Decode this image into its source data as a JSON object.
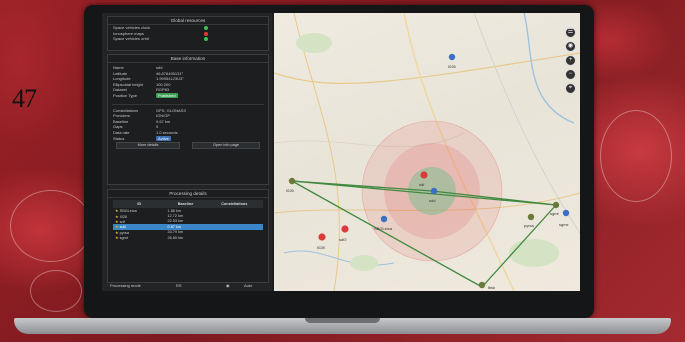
{
  "page_number": "47",
  "global_resources": {
    "title": "Global resources",
    "items": [
      {
        "label": "Space vehicles clock",
        "status_color": "#3fbf4f"
      },
      {
        "label": "Ionosphere maps",
        "status_color": "#e23a2d"
      },
      {
        "label": "Space vehicles orbit",
        "status_color": "#3fbf4f"
      }
    ]
  },
  "base_information": {
    "title": "Base information",
    "fields": [
      {
        "key": "Name",
        "value": "sdd"
      },
      {
        "key": "Latitude",
        "value": "46.878455131°"
      },
      {
        "key": "Longitude",
        "value": "1.99954123U3°"
      },
      {
        "key": "Ellipsoidal height",
        "value": "100.200"
      },
      {
        "key": "Dataset",
        "value": "RGP83"
      },
      {
        "key": "Position Type",
        "value": "Published"
      }
    ],
    "fields2": [
      {
        "key": "Constellations",
        "value": "GPS, GLONASS"
      },
      {
        "key": "Providers",
        "value": "IGN/GP"
      },
      {
        "key": "Baseline",
        "value": "0.67 km"
      },
      {
        "key": "Gaps",
        "value": "0"
      },
      {
        "key": "Data rate",
        "value": "1.0 seconds"
      },
      {
        "key": "Status",
        "value": "Active"
      }
    ],
    "more_details": "More details",
    "open_info": "Open info page"
  },
  "processing_details": {
    "title": "Processing details",
    "headers": [
      "ID",
      "Baseline",
      "Constellations"
    ],
    "rows": [
      {
        "id": "SBGLeica",
        "baseline": "1.88 km"
      },
      {
        "id": "I026",
        "baseline": "12.72 km"
      },
      {
        "id": "sdf",
        "baseline": "22.53 km"
      },
      {
        "id": "sdd",
        "baseline": "0.67 km",
        "selected": true
      },
      {
        "id": "pyrsa",
        "baseline": "33.79 km"
      },
      {
        "id": "sgmt",
        "baseline": "26.80 km"
      }
    ],
    "mode_label": "Processing mode",
    "mode_value": "RS",
    "mode_option": "Auto"
  },
  "map": {
    "pins": [
      {
        "label": "I026",
        "color": "#3a6fc4"
      },
      {
        "label": "I026",
        "color": "#6a7a3a"
      },
      {
        "label": "sdf",
        "color": "#d93b3b"
      },
      {
        "label": "sdd",
        "color": "#3a6fc4"
      },
      {
        "label": "SBGLeica",
        "color": "#3a6fc4"
      },
      {
        "label": "I028",
        "color": "#d93b3b"
      },
      {
        "label": "sdf2",
        "color": "#d93b3b"
      },
      {
        "label": "pyrsa",
        "color": "#6a7a3a"
      },
      {
        "label": "sgmt",
        "color": "#6a7a3a"
      },
      {
        "label": "sgmx",
        "color": "#3a6fc4"
      },
      {
        "label": "lbsk",
        "color": "#6a7a3a"
      }
    ],
    "line_color": "#3f8a3f",
    "circle_color": "#e04848",
    "tools": [
      "layers-icon",
      "target-icon",
      "plus-icon",
      "minus-icon",
      "locate-icon"
    ]
  }
}
